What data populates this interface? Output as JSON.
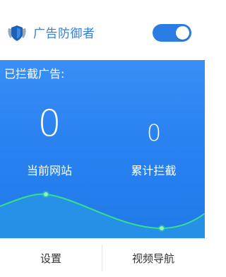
{
  "app": {
    "title": "广告防御者",
    "logo_icon": "shield-icon",
    "toggle_on": true,
    "accent_color": "#2b7de6"
  },
  "main": {
    "section_label": "已拦截广告:",
    "stats": {
      "current_site": {
        "value": "0",
        "label": "当前网站"
      },
      "total_blocked": {
        "value": "0",
        "label": "累计拦截"
      }
    }
  },
  "footer": {
    "settings_label": "设置",
    "video_nav_label": "视频导航"
  }
}
